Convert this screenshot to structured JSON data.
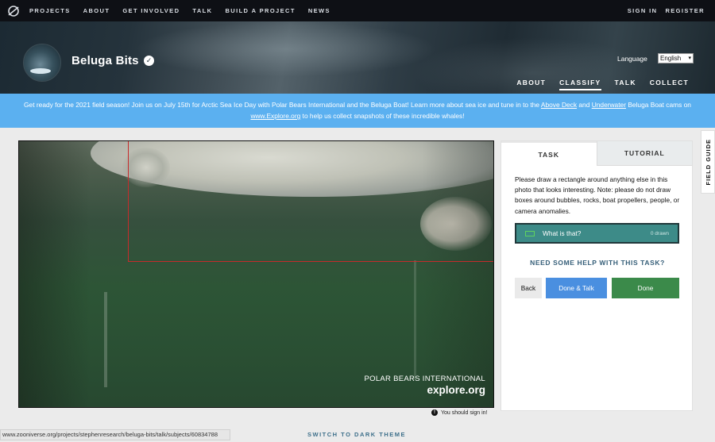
{
  "topnav": {
    "items": [
      "PROJECTS",
      "ABOUT",
      "GET INVOLVED",
      "TALK",
      "BUILD A PROJECT",
      "NEWS"
    ],
    "sign_in": "SIGN IN",
    "register": "REGISTER"
  },
  "project": {
    "title": "Beluga Bits",
    "verified_icon": "✓",
    "language_label": "Language",
    "language_value": "English",
    "nav": [
      "ABOUT",
      "CLASSIFY",
      "TALK",
      "COLLECT"
    ],
    "nav_active": "CLASSIFY"
  },
  "banner": {
    "text_1": "Get ready for the 2021 field season! Join us on July 15th for Arctic Sea Ice Day with Polar Bears International and the Beluga Boat! Learn more about sea ice and tune in to the ",
    "link_1": "Above Deck",
    "text_2": " and ",
    "link_2": "Underwater",
    "text_3": " Beluga Boat cams on ",
    "link_3": "www.Explore.org",
    "text_4": " to help us collect snapshots of these incredible whales!"
  },
  "viewer": {
    "watermark_1": "POLAR BEARS INTERNATIONAL",
    "watermark_2": "explore.org",
    "signin_note": "You should sign in!"
  },
  "panel": {
    "tab_task": "TASK",
    "tab_tutorial": "TUTORIAL",
    "instructions": "Please draw a rectangle around anything else in this photo that looks interesting. Note: please do not draw boxes around bubbles, rocks, boat propellers, people, or camera anomalies.",
    "tool_label": "What is that?",
    "tool_count": "0 drawn",
    "tool_color": "#5fd35f",
    "help": "NEED SOME HELP WITH THIS TASK?",
    "back": "Back",
    "done_talk": "Done & Talk",
    "done": "Done"
  },
  "field_guide": "FIELD GUIDE",
  "status_url": "www.zooniverse.org/projects/stephenresearch/beluga-bits/talk/subjects/60834788",
  "dark_theme": "SWITCH TO DARK THEME"
}
